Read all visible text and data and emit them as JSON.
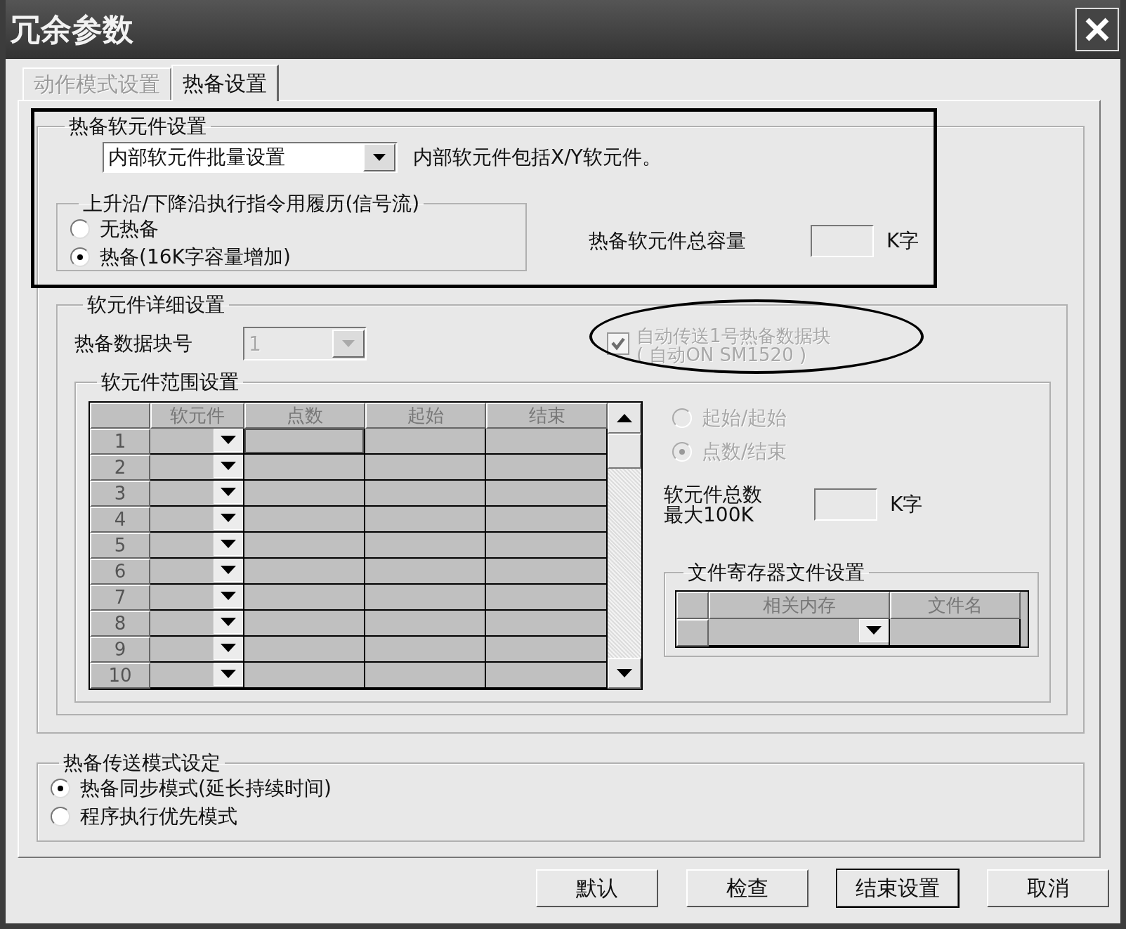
{
  "window": {
    "title": "冗余参数"
  },
  "tabs": [
    {
      "label": "动作模式设置",
      "selected": false
    },
    {
      "label": "热备设置",
      "selected": true
    }
  ],
  "tracking_devices": {
    "title": "热备软元件设置",
    "mode_dropdown": {
      "value": "内部软元件批量设置"
    },
    "note": "内部软元件包括X/Y软元件。",
    "edge_history": {
      "title": "上升沿/下降沿执行指令用履历(信号流)",
      "options": [
        {
          "label": "无热备",
          "selected": false
        },
        {
          "label": "热备(16K字容量增加)",
          "selected": true
        }
      ]
    },
    "capacity": {
      "label": "热备软元件总容量",
      "unit": "K字"
    },
    "detail": {
      "title": "软元件详细设置",
      "block_label": "热备数据块号",
      "block_dropdown": {
        "value": "1",
        "disabled": true
      },
      "auto_transfer": {
        "label": "自动传送1号热备数据块",
        "sublabel": "( 自动ON SM1520 )",
        "checked": true,
        "disabled": true
      },
      "range": {
        "title": "软元件范围设置",
        "columns": [
          "软元件",
          "点数",
          "起始",
          "结束"
        ],
        "rows": [
          "1",
          "2",
          "3",
          "4",
          "5",
          "6",
          "7",
          "8",
          "9",
          "10"
        ],
        "range_mode": [
          {
            "label": "起始/起始",
            "selected": false,
            "disabled": true
          },
          {
            "label": "点数/结束",
            "selected": true,
            "disabled": true
          }
        ],
        "total": {
          "label_lines": [
            "软元件总数",
            "最大100K"
          ],
          "unit": "K字"
        },
        "file_register": {
          "title": "文件寄存器文件设置",
          "columns": [
            "相关内存",
            "文件名"
          ]
        }
      }
    }
  },
  "transfer_mode": {
    "title": "热备传送模式设定",
    "options": [
      {
        "label": "热备同步模式(延长持续时间)",
        "selected": true
      },
      {
        "label": "程序执行优先模式",
        "selected": false
      }
    ]
  },
  "buttons": [
    {
      "label": "默认",
      "default": false
    },
    {
      "label": "检查",
      "default": false
    },
    {
      "label": "结束设置",
      "default": true
    },
    {
      "label": "取消",
      "default": false
    }
  ]
}
